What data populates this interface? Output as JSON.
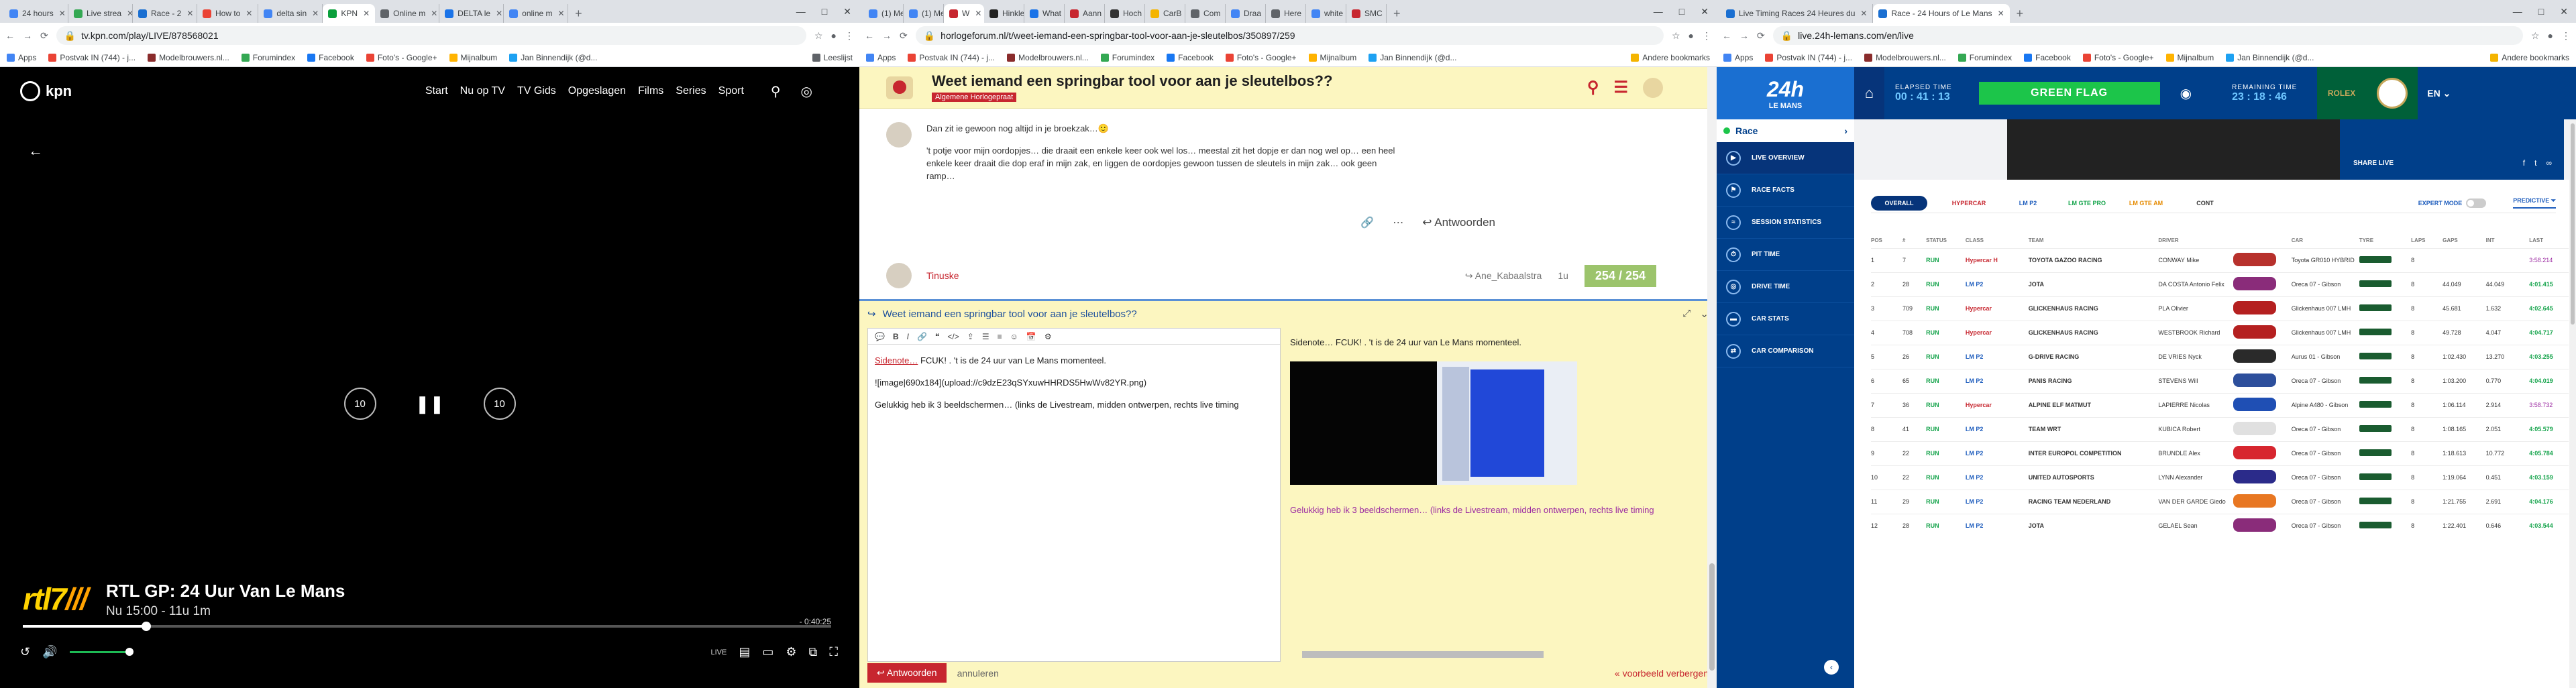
{
  "w1": {
    "tabs": [
      {
        "label": "24 hours",
        "color": "#4285f4"
      },
      {
        "label": "Live strea",
        "color": "#34a853"
      },
      {
        "label": "Race - 2",
        "color": "#1a6fd1"
      },
      {
        "label": "How to",
        "color": "#ea4335"
      },
      {
        "label": "delta sin",
        "color": "#4285f4"
      },
      {
        "label": "KPN",
        "color": "#0a9f3b"
      },
      {
        "label": "Online m",
        "color": "#5f6368"
      },
      {
        "label": "DELTA le",
        "color": "#1a73e8"
      },
      {
        "label": "online m",
        "color": "#4285f4"
      }
    ],
    "url": "tv.kpn.com/play/LIVE/878568021",
    "bookmarks": [
      "Apps",
      "Postvak IN (744) - j...",
      "Modelbrouwers.nl...",
      "Forumindex",
      "Facebook",
      "Foto's - Google+",
      "Mijnalbum",
      "Jan Binnendijk (@d..."
    ],
    "bookmark_right": "Leeslijst",
    "kpn": {
      "logo": "kpn",
      "menu": [
        "Start",
        "Nu op TV",
        "TV Gids",
        "Opgeslagen",
        "Films",
        "Series",
        "Sport"
      ],
      "channel_logo": "rtl7",
      "channel_suffix": "///",
      "title": "RTL GP: 24 Uur Van Le Mans",
      "subtitle": "Nu 15:00 - 11u 1m",
      "time_left": "- 0:40:25",
      "progress": 0.153,
      "live": "LIVE"
    }
  },
  "w2": {
    "tabs": [
      {
        "label": "(1) Me",
        "color": "#4285f4"
      },
      {
        "label": "(1) Me",
        "color": "#4285f4"
      },
      {
        "label": "W",
        "color": "#c7262f"
      },
      {
        "label": "Hinkle",
        "color": "#222"
      },
      {
        "label": "What",
        "color": "#1a73e8"
      },
      {
        "label": "Aann",
        "color": "#c7262f"
      },
      {
        "label": "Hoch",
        "color": "#333"
      },
      {
        "label": "CarB",
        "color": "#f4b400"
      },
      {
        "label": "Com",
        "color": "#5f6368"
      },
      {
        "label": "Draa",
        "color": "#4285f4"
      },
      {
        "label": "Here",
        "color": "#5f6368"
      },
      {
        "label": "white",
        "color": "#4285f4"
      },
      {
        "label": "SMC",
        "color": "#c7262f"
      }
    ],
    "url": "horlogeforum.nl/t/weet-iemand-een-springbar-tool-voor-aan-je-sleutelbos/350897/259",
    "bookmarks": [
      "Apps",
      "Postvak IN (744) - j...",
      "Modelbrouwers.nl...",
      "Forumindex",
      "Facebook",
      "Foto's - Google+",
      "Mijnalbum",
      "Jan Binnendijk (@d..."
    ],
    "bookmark_right": "Andere bookmarks",
    "topic_title": "Weet iemand een springbar tool voor aan je sleutelbos??",
    "category": "Algemene Horlogepraat",
    "post_p1": "Dan zit ie gewoon nog altijd in je broekzak…🙂",
    "post_p2": "'t potje voor mijn oordopjes… die draait een enkele keer ook wel los… meestal zit het dopje er dan nog wel op… een heel enkele keer draait die dop eraf in mijn zak, en liggen de oordopjes gewoon tussen de sleutels in mijn zak… ook geen ramp…",
    "reply_label": "Antwoorden",
    "next_user": "Tinuske",
    "next_reply_to": "Ane_Kabaalstra",
    "next_time": "1u",
    "counter": "254 / 254",
    "composer_title": "Weet iemand een springbar tool voor aan je sleutelbos??",
    "editor_line1_prefix": "Sidenote…",
    "editor_line1_rest": " FCUK! . 't is de 24 uur van Le Mans momenteel.",
    "editor_line2": "![image|690x184](upload://c9dzE23qSYxuwHHRDS5HwWv82YR.png)",
    "editor_line3": "Gelukkig heb ik 3 beeldschermen… (links de Livestream, midden ontwerpen, rechts live timing",
    "preview_line1": "Sidenote… FCUK! . 't is de 24 uur van Le Mans momenteel.",
    "preview_line2": "Gelukkig heb ik 3 beeldschermen… (links de Livestream, midden ontwerpen, rechts live timing",
    "submit": "Antwoorden",
    "cancel": "annuleren",
    "hide_preview": "« voorbeeld verbergen"
  },
  "w3": {
    "tabs": [
      {
        "label": "Live Timing Races 24 Heures du",
        "color": "#1a6fd1"
      },
      {
        "label": "Race - 24 Hours of Le Mans",
        "color": "#1a6fd1"
      }
    ],
    "url": "live.24h-lemans.com/en/live",
    "bookmarks": [
      "Apps",
      "Postvak IN (744) - j...",
      "Modelbrouwers.nl...",
      "Forumindex",
      "Facebook",
      "Foto's - Google+",
      "Mijnalbum",
      "Jan Binnendijk (@d..."
    ],
    "bookmark_right": "Andere bookmarks",
    "brand": "24h",
    "brand_sub": "LE MANS",
    "elapsed_label": "ELAPSED TIME",
    "elapsed": "00 : 41 : 13",
    "flag": "GREEN FLAG",
    "remaining_label": "REMAINING TIME",
    "remaining": "23 : 18 : 46",
    "rolex": "ROLEX",
    "lang": "EN",
    "race_label": "Race",
    "side": [
      "LIVE OVERVIEW",
      "RACE FACTS",
      "SESSION STATISTICS",
      "PIT TIME",
      "DRIVE TIME",
      "CAR STATS",
      "CAR COMPARISON"
    ],
    "share": "SHARE LIVE",
    "filters": [
      "OVERALL",
      "HYPERCAR",
      "LM P2",
      "LM GTE PRO",
      "LM GTE AM",
      "CONT"
    ],
    "filter_colors": [
      "#ffffff",
      "#c7262f",
      "#1e5dbd",
      "#13a34a",
      "#e58a00",
      "#333333"
    ],
    "expert": "EXPERT MODE",
    "predictive": "PREDICTIVE",
    "cols": [
      "POS",
      "#",
      "STATUS",
      "CLASS",
      "TEAM",
      "DRIVER",
      "CAR",
      "TYRE",
      "LAPS",
      "GAPS",
      "INT",
      "LAST"
    ],
    "rows": [
      {
        "pos": "1",
        "num": "7",
        "status": "RUN",
        "cls": "Hypercar H",
        "team": "TOYOTA GAZOO RACING",
        "driver": "CONWAY Mike",
        "car": "Toyota GR010 HYBRID",
        "laps": "8",
        "gap": "",
        "int": "",
        "last": "3:58.214",
        "ccol": "#c7262f",
        "carc": "#b7312c"
      },
      {
        "pos": "2",
        "num": "28",
        "status": "RUN",
        "cls": "LM P2",
        "team": "JOTA",
        "driver": "DA COSTA Antonio Felix",
        "car": "Oreca 07 - Gibson",
        "laps": "8",
        "gap": "44.049",
        "int": "44.049",
        "last": "4:01.415",
        "ccol": "#1e5dbd",
        "carc": "#8a2c7a"
      },
      {
        "pos": "3",
        "num": "709",
        "status": "RUN",
        "cls": "Hypercar",
        "team": "GLICKENHAUS RACING",
        "driver": "PLA Olivier",
        "car": "Glickenhaus 007 LMH",
        "laps": "8",
        "gap": "45.681",
        "int": "1.632",
        "last": "4:02.645",
        "ccol": "#c7262f",
        "carc": "#b52020"
      },
      {
        "pos": "4",
        "num": "708",
        "status": "RUN",
        "cls": "Hypercar",
        "team": "GLICKENHAUS RACING",
        "driver": "WESTBROOK Richard",
        "car": "Glickenhaus 007 LMH",
        "laps": "8",
        "gap": "49.728",
        "int": "4.047",
        "last": "4:04.717",
        "ccol": "#c7262f",
        "carc": "#b52020"
      },
      {
        "pos": "5",
        "num": "26",
        "status": "RUN",
        "cls": "LM P2",
        "team": "G-DRIVE RACING",
        "driver": "DE VRIES Nyck",
        "car": "Aurus 01 - Gibson",
        "laps": "8",
        "gap": "1:02.430",
        "int": "13.270",
        "last": "4:03.255",
        "ccol": "#1e5dbd",
        "carc": "#2a2a2a"
      },
      {
        "pos": "6",
        "num": "65",
        "status": "RUN",
        "cls": "LM P2",
        "team": "PANIS RACING",
        "driver": "STEVENS Will",
        "car": "Oreca 07 - Gibson",
        "laps": "8",
        "gap": "1:03.200",
        "int": "0.770",
        "last": "4:04.019",
        "ccol": "#1e5dbd",
        "carc": "#2d4f9c"
      },
      {
        "pos": "7",
        "num": "36",
        "status": "RUN",
        "cls": "Hypercar",
        "team": "ALPINE ELF MATMUT",
        "driver": "LAPIERRE Nicolas",
        "car": "Alpine A480 - Gibson",
        "laps": "8",
        "gap": "1:06.114",
        "int": "2.914",
        "last": "3:58.732",
        "ccol": "#c7262f",
        "carc": "#1f4fb4"
      },
      {
        "pos": "8",
        "num": "41",
        "status": "RUN",
        "cls": "LM P2",
        "team": "TEAM WRT",
        "driver": "KUBICA Robert",
        "car": "Oreca 07 - Gibson",
        "laps": "8",
        "gap": "1:08.165",
        "int": "2.051",
        "last": "4:05.579",
        "ccol": "#1e5dbd",
        "carc": "#e0e0e0"
      },
      {
        "pos": "9",
        "num": "22",
        "status": "RUN",
        "cls": "LM P2",
        "team": "INTER EUROPOL COMPETITION",
        "driver": "BRUNDLE Alex",
        "car": "Oreca 07 - Gibson",
        "laps": "8",
        "gap": "1:18.613",
        "int": "10.772",
        "last": "4:05.784",
        "ccol": "#1e5dbd",
        "carc": "#d7262f"
      },
      {
        "pos": "10",
        "num": "22",
        "status": "RUN",
        "cls": "LM P2",
        "team": "UNITED AUTOSPORTS",
        "driver": "LYNN Alexander",
        "car": "Oreca 07 - Gibson",
        "laps": "8",
        "gap": "1:19.064",
        "int": "0.451",
        "last": "4:03.159",
        "ccol": "#1e5dbd",
        "carc": "#2b2b8a"
      },
      {
        "pos": "11",
        "num": "29",
        "status": "RUN",
        "cls": "LM P2",
        "team": "RACING TEAM NEDERLAND",
        "driver": "VAN DER GARDE Giedo",
        "car": "Oreca 07 - Gibson",
        "laps": "8",
        "gap": "1:21.755",
        "int": "2.691",
        "last": "4:04.176",
        "ccol": "#1e5dbd",
        "carc": "#e87722"
      },
      {
        "pos": "12",
        "num": "28",
        "status": "RUN",
        "cls": "LM P2",
        "team": "JOTA",
        "driver": "GELAEL Sean",
        "car": "Oreca 07 - Gibson",
        "laps": "8",
        "gap": "1:22.401",
        "int": "0.646",
        "last": "4:03.544",
        "ccol": "#1e5dbd",
        "carc": "#8a2c7a"
      }
    ]
  }
}
